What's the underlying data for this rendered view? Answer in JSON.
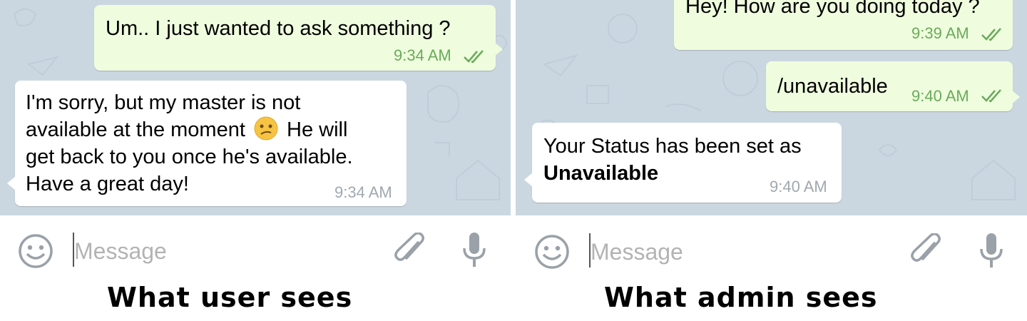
{
  "left_panel": {
    "messages": [
      {
        "text": "Um.. I just wanted to ask something ?",
        "time": "9:34 AM",
        "direction": "outgoing",
        "status": "read"
      },
      {
        "lines": [
          "I'm sorry, but my master is not",
          "available at the moment",
          "He will",
          "get back to you once he's available.",
          "Have a great day!"
        ],
        "emoji": "confused-face",
        "time": "9:34 AM",
        "direction": "incoming"
      }
    ],
    "input_placeholder": "Message",
    "caption": "What user sees"
  },
  "right_panel": {
    "messages": [
      {
        "text": "Hey! How are you doing today ?",
        "time": "9:39 AM",
        "direction": "outgoing",
        "status": "read"
      },
      {
        "text": "/unavailable",
        "time": "9:40 AM",
        "direction": "outgoing",
        "status": "read"
      },
      {
        "line1": "Your Status has been set as",
        "line2": "Unavailable",
        "time": "9:40 AM",
        "direction": "incoming"
      }
    ],
    "input_placeholder": "Message",
    "caption": "What admin sees"
  },
  "colors": {
    "chat_background": "#cbd7e0",
    "outgoing_bubble": "#effdde",
    "incoming_bubble": "#ffffff",
    "outgoing_time": "#6aaa5a",
    "command_text": "#3a7fb0"
  },
  "icons": [
    "smiley-icon",
    "paperclip-icon",
    "microphone-icon",
    "double-check-icon",
    "confused-face-emoji"
  ]
}
